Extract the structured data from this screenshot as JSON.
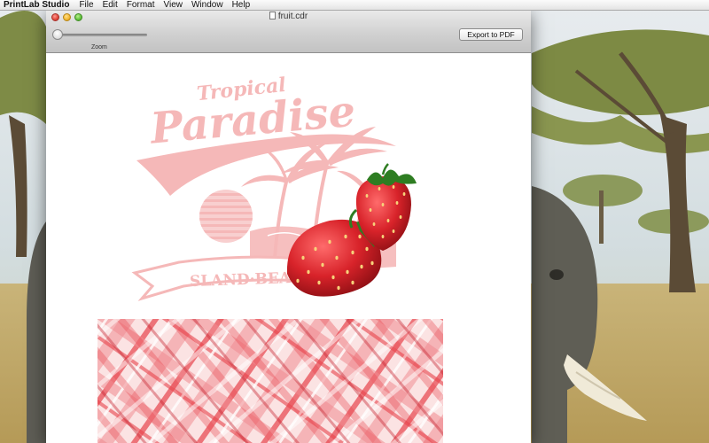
{
  "menubar": {
    "app_name": "PrintLab Studio",
    "items": [
      "File",
      "Edit",
      "Format",
      "View",
      "Window",
      "Help"
    ]
  },
  "window": {
    "document_title": "fruit.cdr",
    "zoom_label": "Zoom",
    "zoom_value": 0,
    "export_label": "Export to PDF"
  },
  "artwork": {
    "headline_small": "Tropical",
    "headline_large": "Paradise",
    "banner_text": "SLAND·BEAC",
    "colors": {
      "pink": "#f5b8b8",
      "strawberry": "#d8232a",
      "leaf": "#2e7d22",
      "plaid_base": "#fbe3e3",
      "plaid_dark": "#e8434b"
    }
  }
}
